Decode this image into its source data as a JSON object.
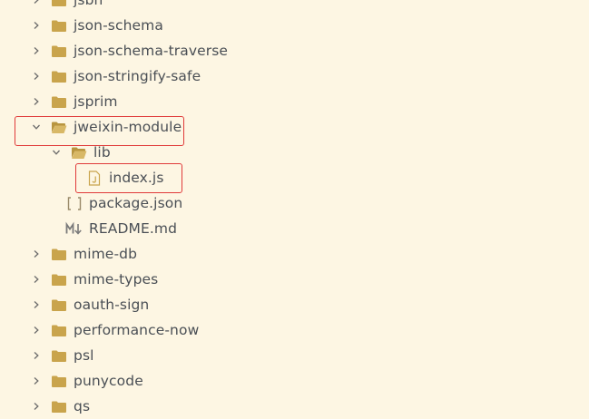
{
  "explorer": {
    "items": [
      {
        "label": "jsbn",
        "type": "folder",
        "state": "collapsed"
      },
      {
        "label": "json-schema",
        "type": "folder",
        "state": "collapsed"
      },
      {
        "label": "json-schema-traverse",
        "type": "folder",
        "state": "collapsed"
      },
      {
        "label": "json-stringify-safe",
        "type": "folder",
        "state": "collapsed"
      },
      {
        "label": "jsprim",
        "type": "folder",
        "state": "collapsed"
      },
      {
        "label": "jweixin-module",
        "type": "folder",
        "state": "expanded"
      },
      {
        "label": "lib",
        "type": "folder",
        "state": "expanded"
      },
      {
        "label": "index.js",
        "type": "file",
        "icon": "js-file-icon"
      },
      {
        "label": "package.json",
        "type": "file",
        "icon": "json-file-icon"
      },
      {
        "label": "README.md",
        "type": "file",
        "icon": "markdown-file-icon"
      },
      {
        "label": "mime-db",
        "type": "folder",
        "state": "collapsed"
      },
      {
        "label": "mime-types",
        "type": "folder",
        "state": "collapsed"
      },
      {
        "label": "oauth-sign",
        "type": "folder",
        "state": "collapsed"
      },
      {
        "label": "performance-now",
        "type": "folder",
        "state": "collapsed"
      },
      {
        "label": "psl",
        "type": "folder",
        "state": "collapsed"
      },
      {
        "label": "punycode",
        "type": "folder",
        "state": "collapsed"
      },
      {
        "label": "qs",
        "type": "folder",
        "state": "collapsed"
      }
    ]
  },
  "colors": {
    "background": "#fdf6e3",
    "folder": "#c9a44c",
    "text": "#4a4f55",
    "highlight_border": "#e03a3a"
  }
}
